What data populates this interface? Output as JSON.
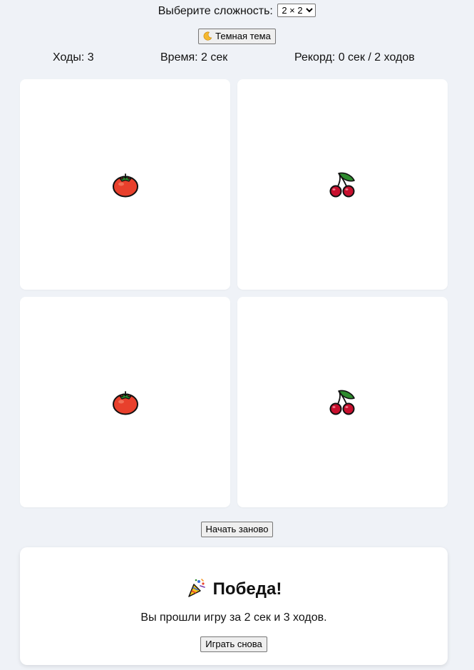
{
  "difficulty": {
    "label": "Выберите сложность:",
    "selected": "2 × 2"
  },
  "theme_button": {
    "icon": "crescent-moon-icon",
    "label": "Темная тема"
  },
  "stats": {
    "moves": "Ходы: 3",
    "time": "Время: 2 сек",
    "record": "Рекорд: 0 сек / 2 ходов"
  },
  "board": {
    "cards": [
      {
        "face": "tomato-icon",
        "state": "matched"
      },
      {
        "face": "cherries-icon",
        "state": "matched"
      },
      {
        "face": "tomato-icon",
        "state": "matched"
      },
      {
        "face": "cherries-icon",
        "state": "matched"
      }
    ]
  },
  "restart_label": "Начать заново",
  "win": {
    "icon": "party-popper-icon",
    "title": "Победа!",
    "message": "Вы прошли игру за 2 сек и 3 ходов.",
    "play_again_label": "Играть снова"
  },
  "colors": {
    "page_background": "#eff2f7",
    "card_background": "#ffffff",
    "tomato_red": "#e8402c",
    "cherry_red": "#c8102e",
    "leaf_green": "#2e8b2e"
  }
}
